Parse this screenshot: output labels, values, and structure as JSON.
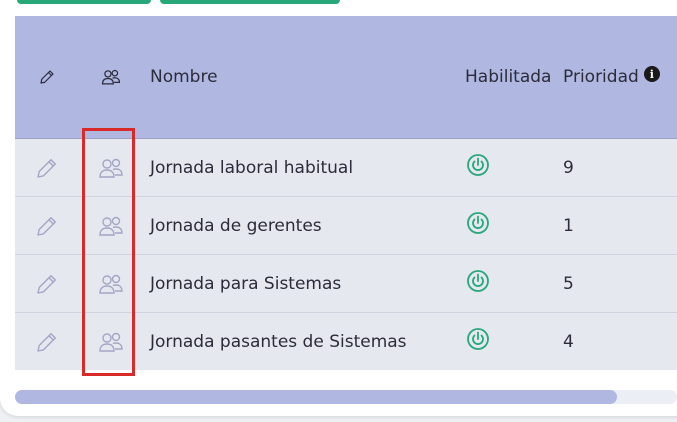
{
  "table": {
    "headers": {
      "name": "Nombre",
      "enabled": "Habilitada",
      "priority": "Prioridad",
      "priority_info_glyph": "i"
    },
    "rows": [
      {
        "name": "Jornada laboral habitual",
        "enabled_icon": "power-icon",
        "priority": "9"
      },
      {
        "name": "Jornada de gerentes",
        "enabled_icon": "power-icon",
        "priority": "1"
      },
      {
        "name": "Jornada para Sistemas",
        "enabled_icon": "power-icon",
        "priority": "5"
      },
      {
        "name": "Jornada pasantes de Sistemas",
        "enabled_icon": "power-icon",
        "priority": "4"
      }
    ],
    "row_icons": [
      "pencil-icon",
      "users-icon"
    ],
    "horizontal_scroll_fraction": 0.91
  },
  "colors": {
    "header_bg": "#b0b8e2",
    "row_bg": "#e6e8f0",
    "enabled_green": "#27a77a",
    "highlight_red": "#d92a2a",
    "icon_muted": "#a3a6c4",
    "top_button": "#27a77a"
  }
}
